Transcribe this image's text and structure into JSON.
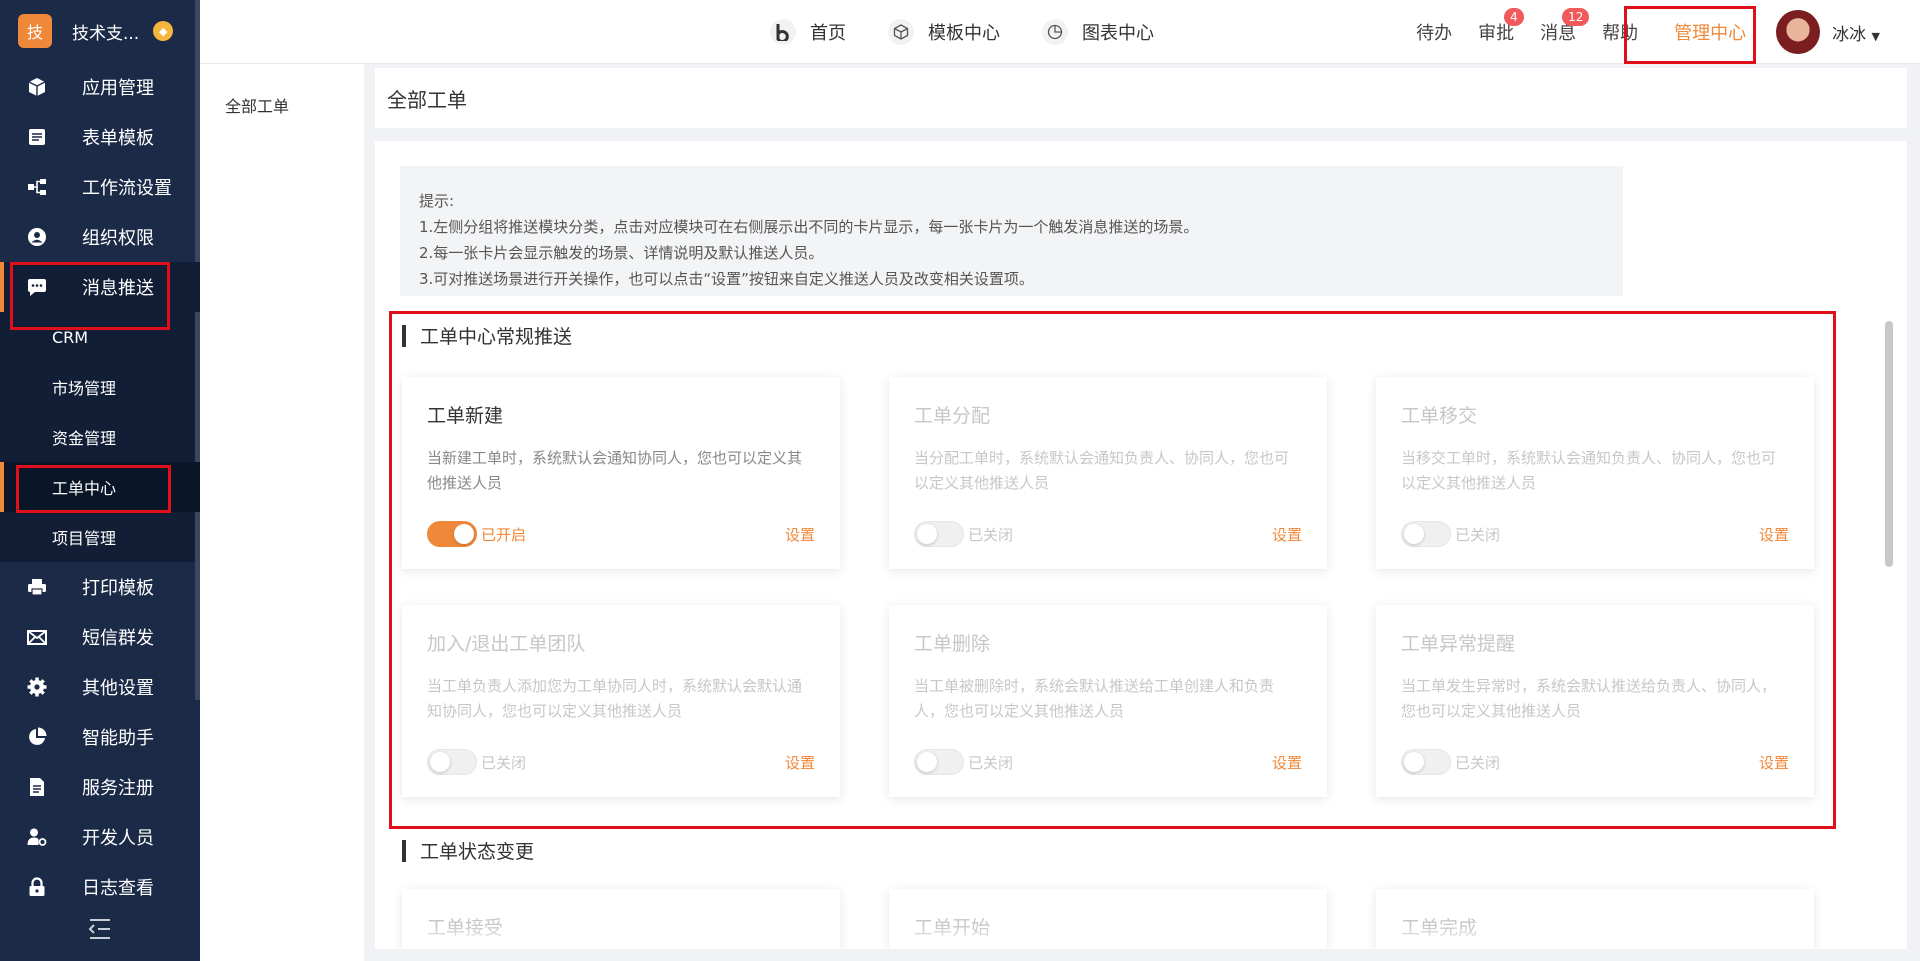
{
  "brand": {
    "logo_text": "技",
    "name": "技术支..."
  },
  "sidebar": {
    "items": [
      {
        "label": "应用管理",
        "icon": "cube-icon"
      },
      {
        "label": "表单模板",
        "icon": "form-icon"
      },
      {
        "label": "工作流设置",
        "icon": "workflow-icon"
      },
      {
        "label": "组织权限",
        "icon": "user-icon"
      },
      {
        "label": "消息推送",
        "icon": "message-icon",
        "active": true
      },
      {
        "label": "打印模板",
        "icon": "printer-icon"
      },
      {
        "label": "短信群发",
        "icon": "mail-icon"
      },
      {
        "label": "其他设置",
        "icon": "gear-icon"
      },
      {
        "label": "智能助手",
        "icon": "pie-icon"
      },
      {
        "label": "服务注册",
        "icon": "document-icon"
      },
      {
        "label": "开发人员",
        "icon": "developer-icon"
      },
      {
        "label": "日志查看",
        "icon": "lock-icon"
      }
    ],
    "sub_items": [
      {
        "label": "CRM"
      },
      {
        "label": "市场管理"
      },
      {
        "label": "资金管理"
      },
      {
        "label": "工单中心",
        "active": true
      },
      {
        "label": "项目管理"
      }
    ]
  },
  "topbar": {
    "nav": [
      {
        "label": "首页",
        "icon": "b-logo-icon"
      },
      {
        "label": "模板中心",
        "icon": "cube-outline-icon"
      },
      {
        "label": "图表中心",
        "icon": "pie-outline-icon"
      }
    ],
    "todo": "待办",
    "approval": "审批",
    "approval_badge": "4",
    "messages": "消息",
    "messages_badge": "12",
    "help": "帮助",
    "admin_center": "管理中心",
    "username": "冰冰"
  },
  "subpanel": {
    "item": "全部工单"
  },
  "page": {
    "title": "全部工单"
  },
  "tips": {
    "heading": "提示:",
    "lines": [
      "1.左侧分组将推送模块分类，点击对应模块可在右侧展示出不同的卡片显示，每一张卡片为一个触发消息推送的场景。",
      "2.每一张卡片会显示触发的场景、详情说明及默认推送人员。",
      "3.可对推送场景进行开关操作，也可以点击“设置”按钮来自定义推送人员及改变相关设置项。"
    ]
  },
  "sections": [
    {
      "title": "工单中心常规推送",
      "cards": [
        {
          "title": "工单新建",
          "desc": "当新建工单时，系统默认会通知协同人，您也可以定义其他推送人员",
          "on": true,
          "status": "已开启",
          "setting": "设置"
        },
        {
          "title": "工单分配",
          "desc": "当分配工单时，系统默认会通知负责人、协同人，您也可以定义其他推送人员",
          "on": false,
          "status": "已关闭",
          "setting": "设置"
        },
        {
          "title": "工单移交",
          "desc": "当移交工单时，系统默认会通知负责人、协同人，您也可以定义其他推送人员",
          "on": false,
          "status": "已关闭",
          "setting": "设置"
        },
        {
          "title": "加入/退出工单团队",
          "desc": "当工单负责人添加您为工单协同人时，系统默认会默认通知协同人，您也可以定义其他推送人员",
          "on": false,
          "status": "已关闭",
          "setting": "设置"
        },
        {
          "title": "工单删除",
          "desc": "当工单被删除时，系统会默认推送给工单创建人和负责人，您也可以定义其他推送人员",
          "on": false,
          "status": "已关闭",
          "setting": "设置"
        },
        {
          "title": "工单异常提醒",
          "desc": "当工单发生异常时，系统会默认推送给负责人、协同人，您也可以定义其他推送人员",
          "on": false,
          "status": "已关闭",
          "setting": "设置"
        }
      ]
    },
    {
      "title": "工单状态变更",
      "cards": [
        {
          "title": "工单接受"
        },
        {
          "title": "工单开始"
        },
        {
          "title": "工单完成"
        }
      ]
    }
  ],
  "colors": {
    "accent": "#f0883a",
    "sidebar_bg": "#1b2a47",
    "highlight_box": "#e0101a"
  }
}
